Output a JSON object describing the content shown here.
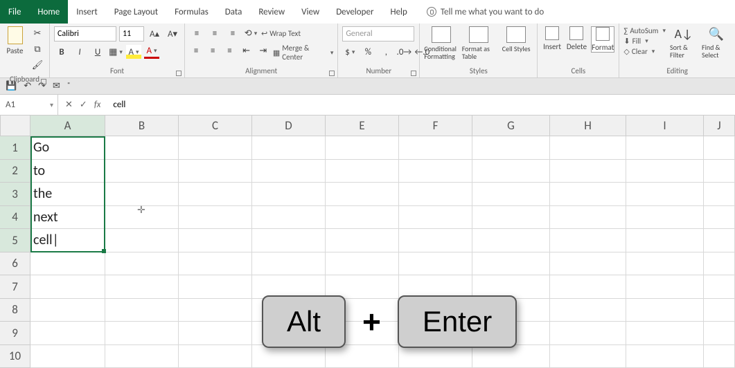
{
  "menubar": {
    "file": "File",
    "tabs": [
      "Home",
      "Insert",
      "Page Layout",
      "Formulas",
      "Data",
      "Review",
      "View",
      "Developer",
      "Help"
    ],
    "active_index": 0,
    "tell_me": "Tell me what you want to do"
  },
  "ribbon": {
    "clipboard": {
      "paste": "Paste",
      "label": "Clipboard"
    },
    "font": {
      "name": "Calibri",
      "size": "11",
      "buttons": {
        "bold": "B",
        "italic": "I",
        "underline": "U"
      },
      "label": "Font"
    },
    "alignment": {
      "wrap": "Wrap Text",
      "merge": "Merge & Center",
      "label": "Alignment"
    },
    "number": {
      "format": "General",
      "label": "Number"
    },
    "styles": {
      "cond": "Conditional Formatting",
      "table": "Format as Table",
      "cell": "Cell Styles",
      "label": "Styles"
    },
    "cells": {
      "insert": "Insert",
      "delete": "Delete",
      "format": "Format",
      "label": "Cells"
    },
    "editing": {
      "autosum": "AutoSum",
      "fill": "Fill",
      "clear": "Clear",
      "sort": "Sort & Filter",
      "find": "Find & Select",
      "label": "Editing"
    }
  },
  "qat": {
    "save": "💾",
    "undo": "↶",
    "redo": "↷",
    "mail": "✉"
  },
  "formula_bar": {
    "namebox": "A1",
    "cancel": "✕",
    "enter": "✓",
    "fx": "fx",
    "content": "cell"
  },
  "columns": [
    "A",
    "B",
    "C",
    "D",
    "E",
    "F",
    "G",
    "H",
    "I",
    "J"
  ],
  "row_numbers": [
    "1",
    "2",
    "3",
    "4",
    "5",
    "6",
    "7",
    "8",
    "9",
    "10"
  ],
  "cells": {
    "A1": "Go",
    "A2": "to",
    "A3": "the",
    "A4": "next",
    "A5": "cell"
  },
  "overlay": {
    "key1": "Alt",
    "plus": "+",
    "key2": "Enter"
  }
}
